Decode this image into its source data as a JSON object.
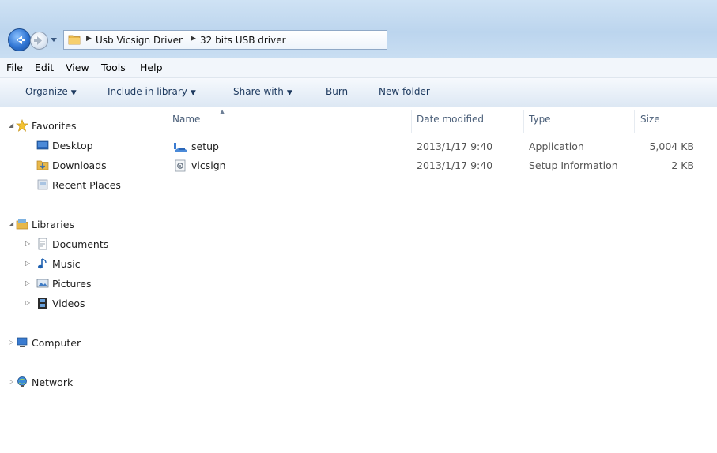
{
  "address": {
    "crumbs": [
      "Usb Vicsign Driver",
      "32 bits USB driver"
    ]
  },
  "menubar": {
    "items": [
      "File",
      "Edit",
      "View",
      "Tools",
      "Help"
    ]
  },
  "toolbar": {
    "organize": "Organize",
    "include_in_library": "Include in library",
    "share_with": "Share with",
    "burn": "Burn",
    "new_folder": "New folder"
  },
  "nav": {
    "favorites": "Favorites",
    "desktop": "Desktop",
    "downloads": "Downloads",
    "recent_places": "Recent Places",
    "libraries": "Libraries",
    "documents": "Documents",
    "music": "Music",
    "pictures": "Pictures",
    "videos": "Videos",
    "computer": "Computer",
    "network": "Network"
  },
  "columns": {
    "name": "Name",
    "date_modified": "Date modified",
    "type": "Type",
    "size": "Size"
  },
  "files": [
    {
      "name": "setup",
      "date": "2013/1/17 9:40",
      "type": "Application",
      "size": "5,004 KB",
      "icon": "application-icon"
    },
    {
      "name": "vicsign",
      "date": "2013/1/17 9:40",
      "type": "Setup Information",
      "size": "2 KB",
      "icon": "setup-info-icon"
    }
  ],
  "colors": {
    "accent": "#2f74d2",
    "folder": "#e8b84a"
  }
}
